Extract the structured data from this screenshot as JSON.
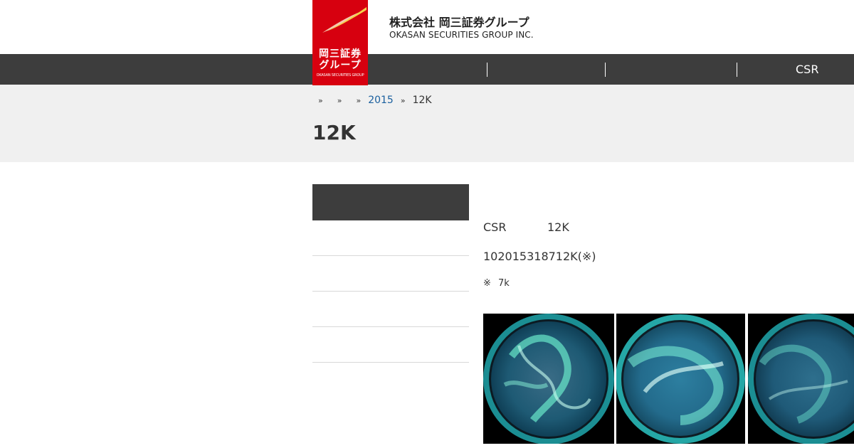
{
  "header": {
    "logo_text_line1": "岡三証券",
    "logo_text_line2": "グループ",
    "logo_text_en": "OKASAN SECURITIES GROUP",
    "company_name_jp": "株式会社 岡三証券グループ",
    "company_name_en": "OKASAN SECURITIES GROUP INC.",
    "brand_color": "#d7000f"
  },
  "nav": {
    "items": [
      "",
      "",
      "",
      "CSR"
    ],
    "bar_color": "#3d3d3d"
  },
  "breadcrumb": {
    "items": [
      "",
      "",
      "2015",
      "12K"
    ],
    "link_color": "#1a5f9e"
  },
  "page": {
    "title": "12K"
  },
  "sidebar": {
    "items": [
      "",
      "",
      "",
      ""
    ]
  },
  "content": {
    "line1_left": "CSR",
    "line1_right": "12K",
    "line2": "102015318712K(※)",
    "note_mark": "※",
    "note_text": "7k"
  },
  "photos": [
    {
      "name": "aurora-photo-1"
    },
    {
      "name": "aurora-photo-2"
    },
    {
      "name": "aurora-photo-3"
    }
  ]
}
